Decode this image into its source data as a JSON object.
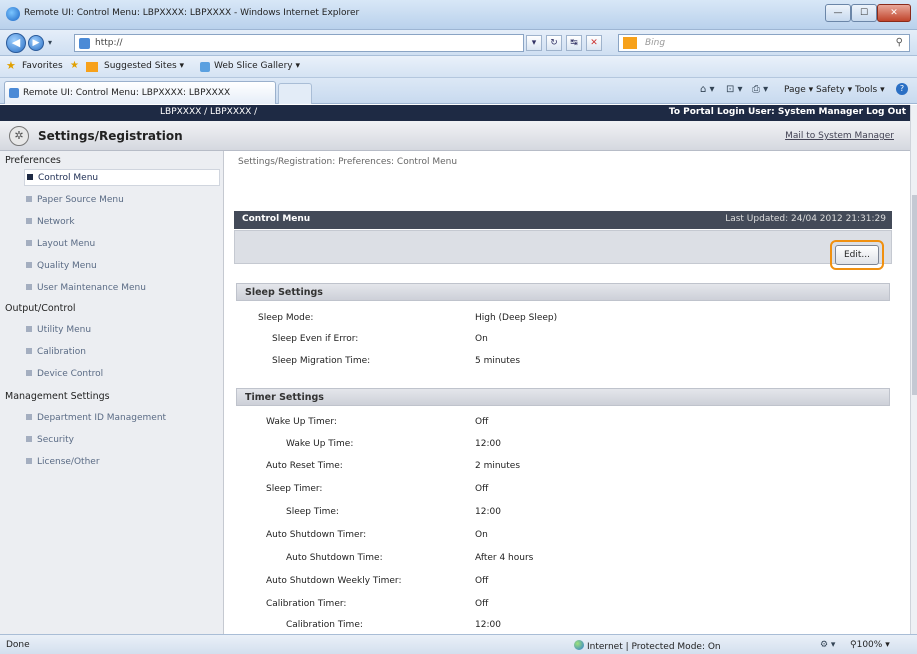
{
  "window": {
    "title": "Remote UI: Control Menu: LBPXXXX: LBPXXXX - Windows Internet Explorer",
    "min": "—",
    "max": "☐",
    "close": "✕"
  },
  "address": {
    "url": "http://",
    "search_placeholder": "Bing"
  },
  "favorites": {
    "label": "Favorites",
    "suggested": "Suggested Sites ▾",
    "webslice": "Web Slice Gallery ▾"
  },
  "tabs": {
    "active": "Remote UI: Control Menu: LBPXXXX: LBPXXXX",
    "commands": "Page ▾  Safety ▾  Tools ▾"
  },
  "header": {
    "device": "LBPXXXX / LBPXXXX /",
    "right": "To Portal   Login User: System Manager   Log Out",
    "title": "Settings/Registration",
    "mail": "Mail to System Manager"
  },
  "sidebar": {
    "sections": [
      {
        "label": "Preferences",
        "items": [
          "Control Menu",
          "Paper Source Menu",
          "Network",
          "Layout Menu",
          "Quality Menu",
          "User Maintenance Menu"
        ]
      },
      {
        "label": "Output/Control",
        "items": [
          "Utility Menu",
          "Calibration",
          "Device Control"
        ]
      },
      {
        "label": "Management Settings",
        "items": [
          "Department ID Management",
          "Security",
          "License/Other"
        ]
      }
    ]
  },
  "main": {
    "breadcrumb": "Settings/Registration: Preferences: Control Menu",
    "block_title": "Control Menu",
    "last_updated": "Last Updated: 24/04 2012 21:31:29",
    "edit_label": "Edit...",
    "sleep": {
      "title": "Sleep Settings",
      "rows": [
        {
          "label": "Sleep Mode:",
          "value": "High (Deep Sleep)"
        },
        {
          "label": "Sleep Even if Error:",
          "value": "On"
        },
        {
          "label": "Sleep Migration Time:",
          "value": "5 minutes"
        }
      ]
    },
    "timer": {
      "title": "Timer Settings",
      "rows": [
        {
          "label": "Wake Up Timer:",
          "value": "Off"
        },
        {
          "label": "Wake Up Time:",
          "value": "12:00"
        },
        {
          "label": "Auto Reset Time:",
          "value": "2 minutes"
        },
        {
          "label": "Sleep Timer:",
          "value": "Off"
        },
        {
          "label": "Sleep Time:",
          "value": "12:00"
        },
        {
          "label": "Auto Shutdown Timer:",
          "value": "On"
        },
        {
          "label": "Auto Shutdown Time:",
          "value": "After 4 hours"
        },
        {
          "label": "Auto Shutdown Weekly Timer:",
          "value": "Off"
        },
        {
          "label": "Calibration Timer:",
          "value": "Off"
        },
        {
          "label": "Calibration Time:",
          "value": "12:00"
        }
      ]
    }
  },
  "status": {
    "left": "Done",
    "zone": "Internet | Protected Mode: On",
    "zoom": "100%"
  }
}
